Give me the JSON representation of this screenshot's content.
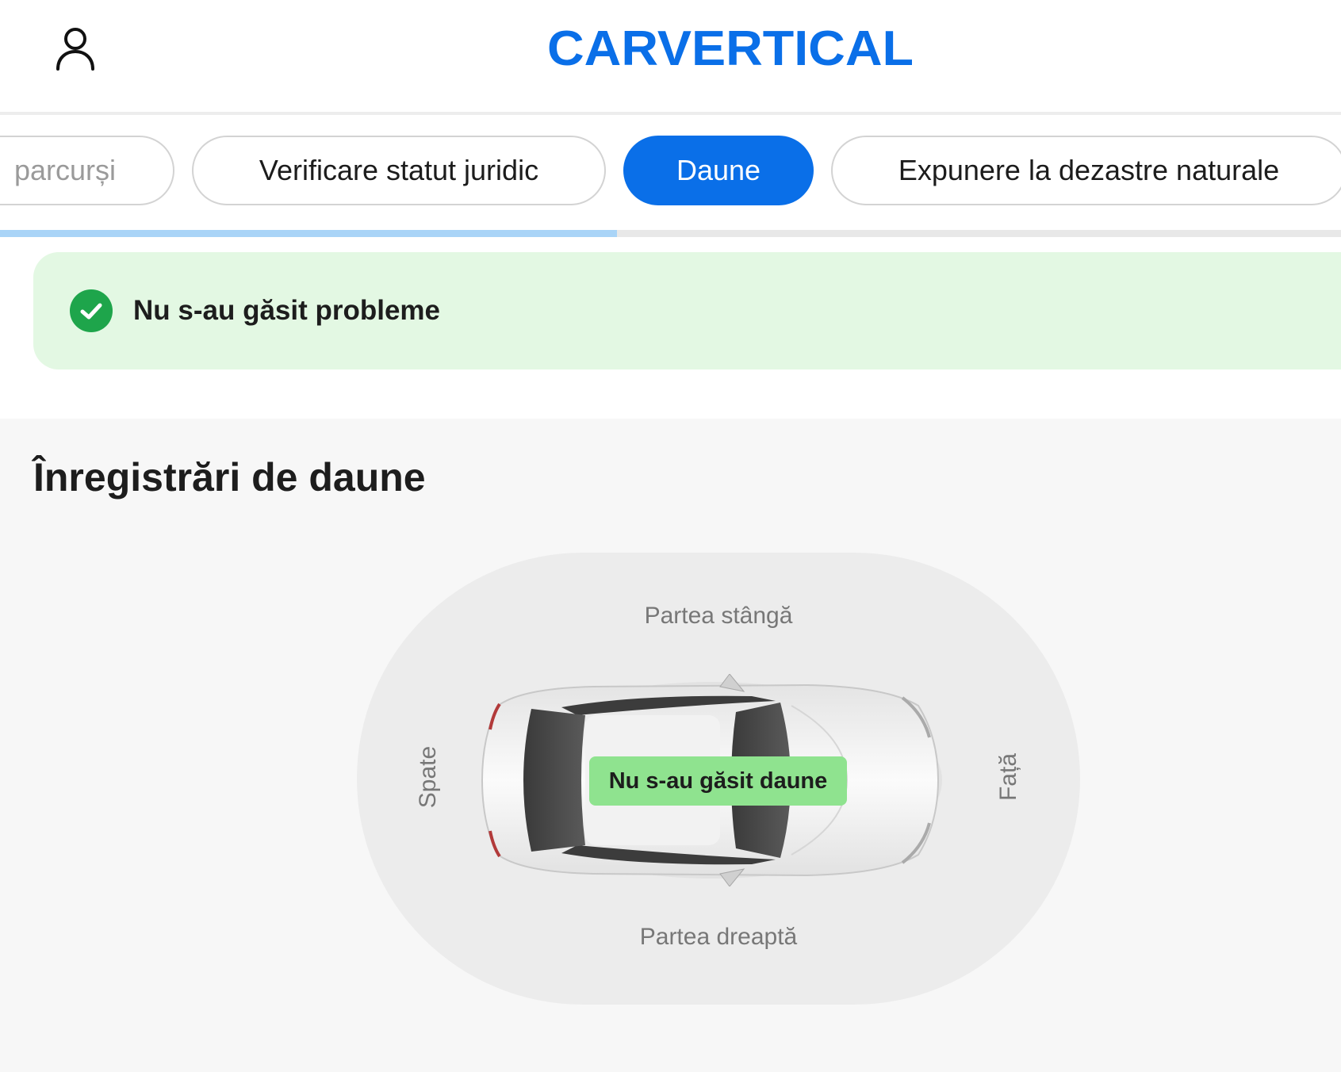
{
  "header": {
    "logo_text": "CARVERTICAL",
    "brand_color": "#0a6fe8",
    "user_icon": "user-icon"
  },
  "tabs": [
    {
      "label": "parcurși",
      "active": false
    },
    {
      "label": "Verificare statut juridic",
      "active": false
    },
    {
      "label": "Daune",
      "active": true
    },
    {
      "label": "Expunere la dezastre naturale",
      "active": false
    }
  ],
  "progress": {
    "fraction": 0.46
  },
  "status": {
    "icon": "check-circle-icon",
    "text": "Nu s-au găsit probleme",
    "background": "#e3f8e3",
    "icon_color": "#1ea54b"
  },
  "records": {
    "title": "Înregistrări de daune",
    "diagram": {
      "left_side": "Partea stângă",
      "right_side": "Partea dreaptă",
      "back": "Spate",
      "front": "Față",
      "badge": "Nu s-au găsit daune",
      "badge_color": "#8fe38f"
    }
  }
}
